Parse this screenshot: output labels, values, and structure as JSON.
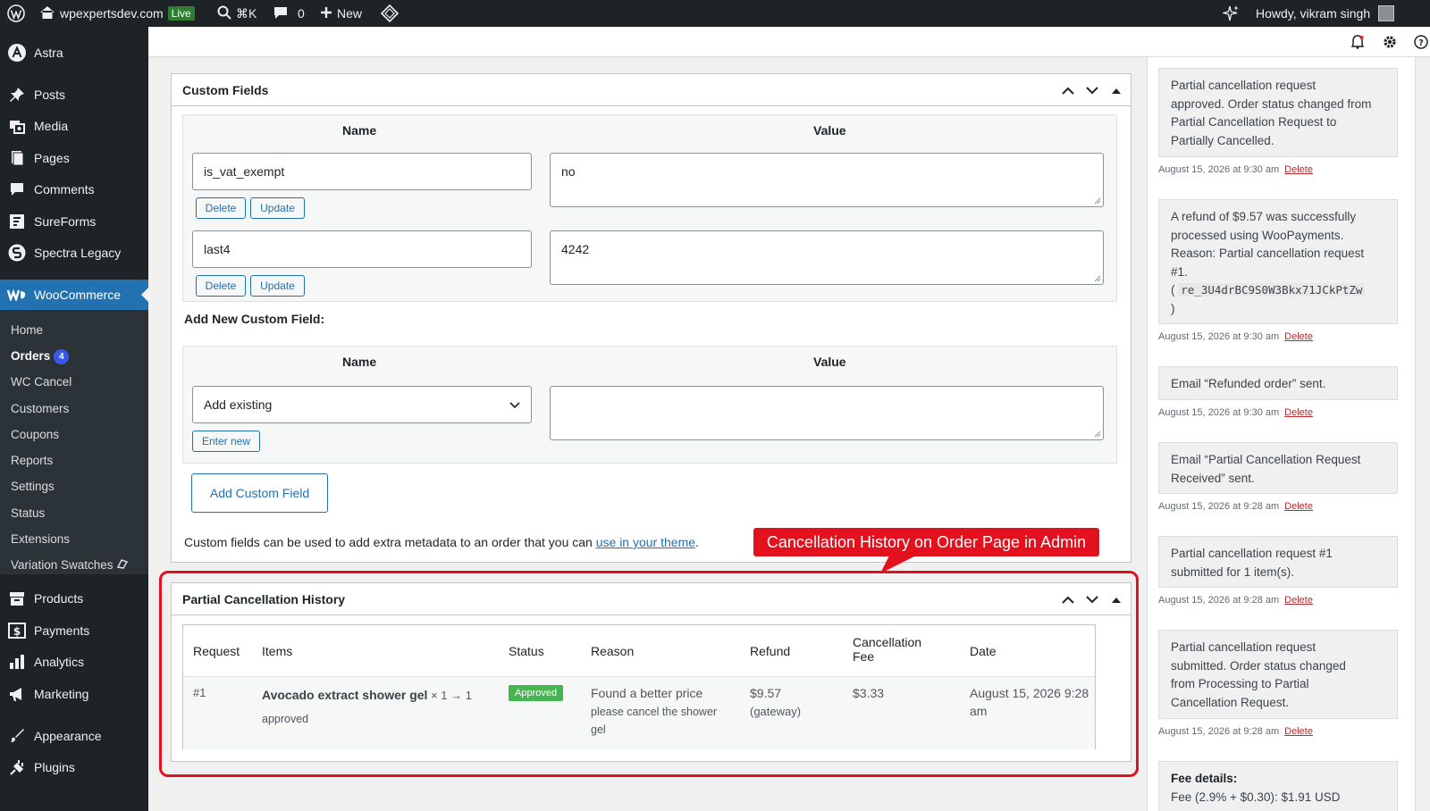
{
  "adminbar": {
    "site_name": "wpexpertsdev.com",
    "live_badge": "Live",
    "shortcut": "⌘K",
    "comments_count": "0",
    "new_label": "New",
    "howdy": "Howdy, vikram singh"
  },
  "sidebar": {
    "top_item": "Astra",
    "items": [
      {
        "label": "Posts",
        "icon": "pin-icon"
      },
      {
        "label": "Media",
        "icon": "media-icon"
      },
      {
        "label": "Pages",
        "icon": "pages-icon"
      },
      {
        "label": "Comments",
        "icon": "comment-icon"
      },
      {
        "label": "SureForms",
        "icon": "form-icon"
      },
      {
        "label": "Spectra Legacy",
        "icon": "spectra-icon"
      }
    ],
    "active_item": "WooCommerce",
    "submenu": [
      {
        "label": "Home"
      },
      {
        "label": "Orders",
        "badge": "4"
      },
      {
        "label": "WC Cancel"
      },
      {
        "label": "Customers"
      },
      {
        "label": "Coupons"
      },
      {
        "label": "Reports"
      },
      {
        "label": "Settings"
      },
      {
        "label": "Status"
      },
      {
        "label": "Extensions"
      },
      {
        "label": "Variation Swatches"
      }
    ],
    "lower_items": [
      {
        "label": "Products",
        "icon": "archive-icon"
      },
      {
        "label": "Payments",
        "icon": "dollar-icon"
      },
      {
        "label": "Analytics",
        "icon": "bar-chart-icon"
      },
      {
        "label": "Marketing",
        "icon": "megaphone-icon"
      },
      {
        "label": "Appearance",
        "icon": "brush-icon"
      },
      {
        "label": "Plugins",
        "icon": "plug-icon"
      }
    ]
  },
  "custom_fields": {
    "title": "Custom Fields",
    "col_name": "Name",
    "col_value": "Value",
    "rows": [
      {
        "name": "is_vat_exempt",
        "value": "no"
      },
      {
        "name": "last4",
        "value": "4242"
      }
    ],
    "delete_label": "Delete",
    "update_label": "Update",
    "add_new_title": "Add New Custom Field:",
    "select_value": "Add existing",
    "enter_new_label": "Enter new",
    "add_button": "Add Custom Field",
    "help_text": "Custom fields can be used to add extra metadata to an order that you can ",
    "help_link": "use in your theme",
    "help_end": "."
  },
  "annotation": {
    "label": "Cancellation History on Order Page in Admin",
    "color": "#e3101e"
  },
  "history": {
    "title": "Partial Cancellation History",
    "headers": {
      "request": "Request",
      "items": "Items",
      "status": "Status",
      "reason": "Reason",
      "refund": "Refund",
      "fee_line1": "Cancellation",
      "fee_line2": "Fee",
      "date": "Date"
    },
    "row": {
      "request": "#1",
      "item_name": "Avocado extract shower gel",
      "item_qty": " × 1 → 1",
      "item_status": "approved",
      "status": "Approved",
      "reason_title": "Found a better price",
      "reason_line1": "please cancel the shower",
      "reason_line2": "gel",
      "refund": "$9.57",
      "refund_method": "(gateway)",
      "fee": "$3.33",
      "date_line1": "August 15, 2026 9:28",
      "date_line2": "am"
    }
  },
  "notes": [
    {
      "lines": [
        "Partial cancellation request",
        "approved. Order status changed from",
        "Partial Cancellation Request to",
        "Partially Cancelled."
      ],
      "meta": "August 15, 2026 at 9:30 am"
    },
    {
      "lines": [
        "A refund of $9.57 was successfully",
        "processed using WooPayments.",
        "Reason: Partial cancellation request",
        "#1."
      ],
      "txn_open": "( ",
      "txn": "re_3U4drBC9S0W3Bkx71JCkPtZw",
      "txn_close": ")",
      "meta": "August 15, 2026 at 9:30 am"
    },
    {
      "lines": [
        "Email “Refunded order” sent."
      ],
      "meta": "August 15, 2026 at 9:30 am"
    },
    {
      "lines": [
        "Email “Partial Cancellation Request",
        "Received” sent."
      ],
      "meta": "August 15, 2026 at 9:28 am"
    },
    {
      "lines": [
        "Partial cancellation request #1",
        "submitted for 1 item(s)."
      ],
      "meta": "August 15, 2026 at 9:28 am"
    },
    {
      "lines": [
        "Partial cancellation request",
        "submitted. Order status changed",
        "from Processing to Partial",
        "Cancellation Request."
      ],
      "meta": "August 15, 2026 at 9:28 am"
    },
    {
      "title": "Fee details:",
      "lines": [
        "Fee (2.9% + $0.30): $1.91 USD"
      ]
    }
  ],
  "delete_note_label": "Delete",
  "colors": {
    "adminbar_bg": "#1d2327",
    "active_menu": "#2271b1",
    "approved": "#46b450",
    "link": "#2271b1",
    "delete_link": "#b32d2e"
  }
}
